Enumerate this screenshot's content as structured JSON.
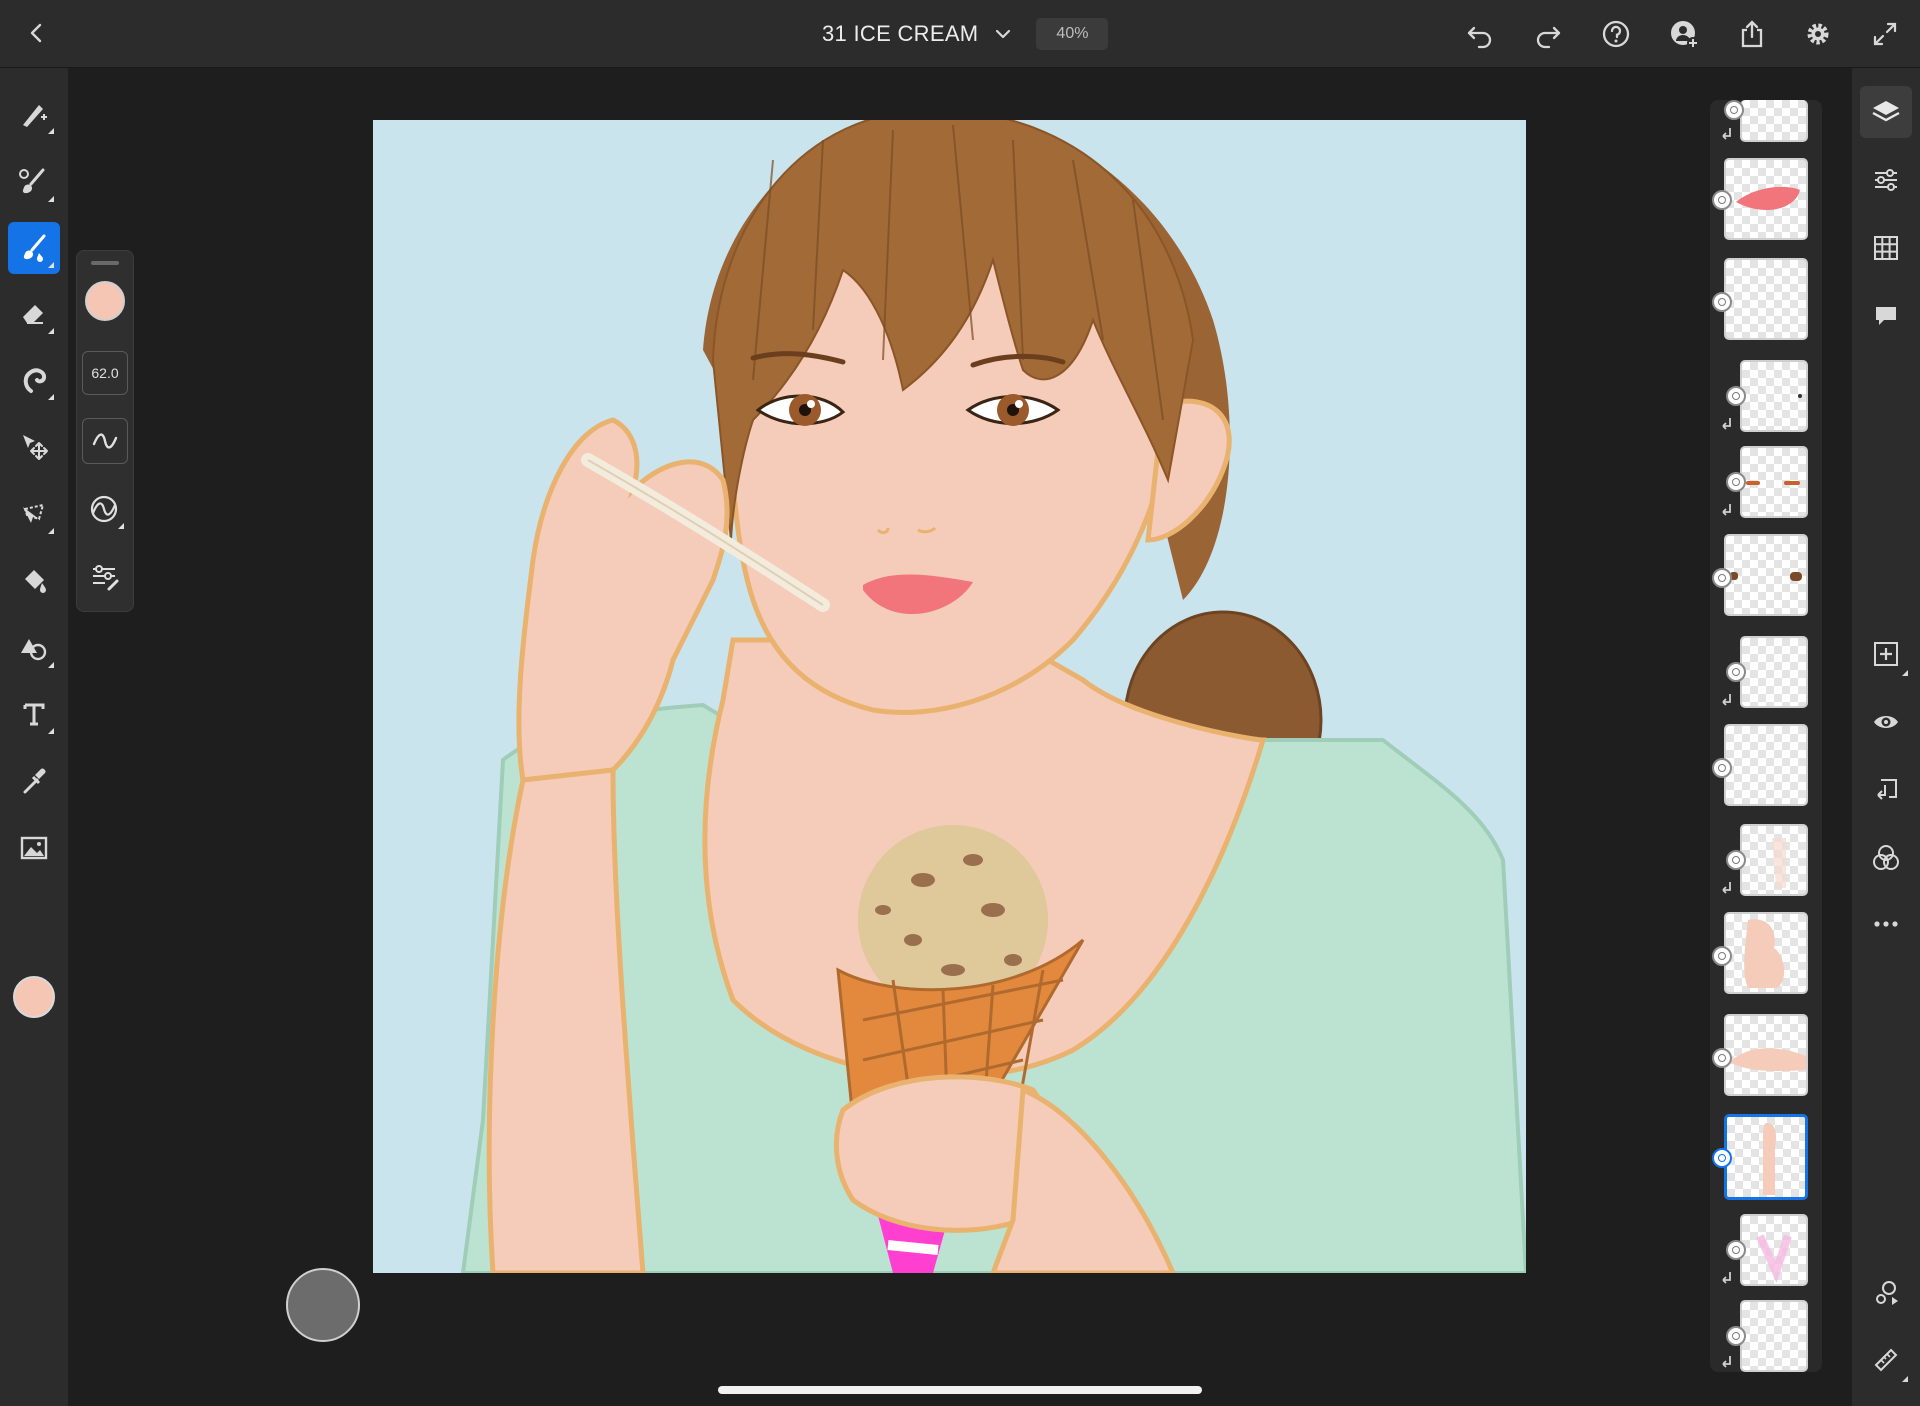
{
  "app": {
    "document_title": "31 ICE CREAM",
    "zoom": "40%"
  },
  "brush": {
    "size": "62.0",
    "color": "#f5c6b4"
  },
  "colors": {
    "accent": "#1473e6",
    "canvas_bg": "#cae4ee",
    "skin": "#f5c6b4"
  },
  "canvas": {
    "illustration": "girl eating ice cream cone"
  },
  "toolbar": {
    "left_tools": [
      "quick-actions-icon",
      "pixel-brush-icon",
      "live-brush-icon",
      "eraser-icon",
      "smudge-icon",
      "move-icon",
      "lasso-icon",
      "fill-icon",
      "shape-icon",
      "text-icon",
      "eyedropper-icon",
      "image-icon"
    ],
    "right_tools": [
      "layers-icon",
      "adjustments-icon",
      "grid-icon",
      "comments-icon",
      "add-layer-icon",
      "visibility-icon",
      "import-icon",
      "blend-modes-icon",
      "more-icon",
      "character-icon",
      "ruler-icon"
    ]
  },
  "layers": {
    "count": 15,
    "selected_index": 11
  }
}
